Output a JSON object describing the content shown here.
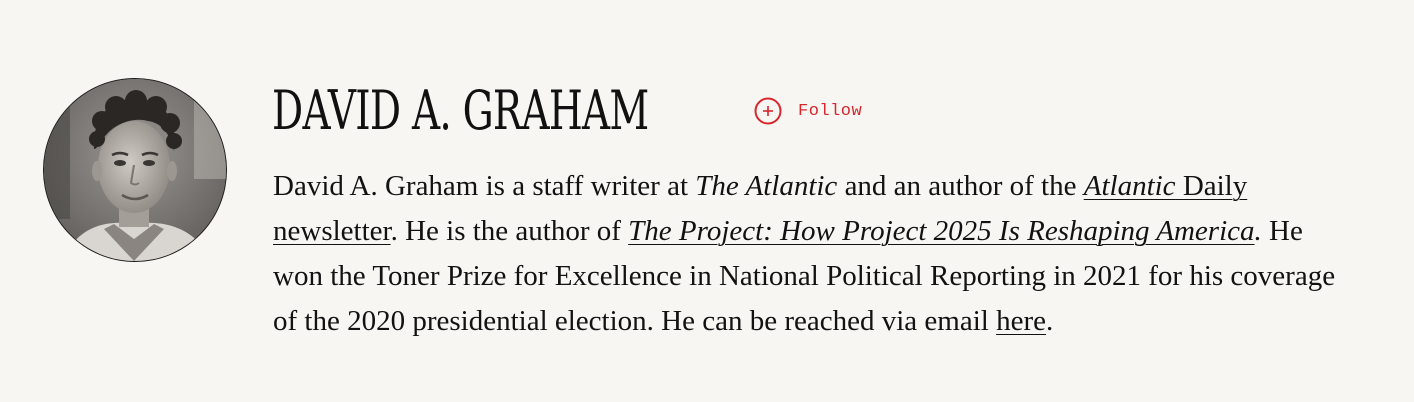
{
  "author": {
    "name": "DAVID A. GRAHAM",
    "avatar_alt": "David A. Graham",
    "follow_label": "Follow"
  },
  "bio": {
    "t1": "David A. Graham is a staff writer at ",
    "publication": "The Atlantic",
    "t2": " and an author of the ",
    "newsletter_italic": "Atlantic",
    "newsletter_rest": " Daily newsletter",
    "t3": ". He is the author of ",
    "book_title": "The Project: How Project 2025 Is Reshaping America",
    "book_period": ".",
    "t4": " He won the Toner Prize for Excellence in National Political Reporting in 2021 for his coverage of the 2020 presidential election. He can be reached via email ",
    "email_link": "here",
    "t5": "."
  },
  "colors": {
    "background": "#f7f6f3",
    "text": "#121212",
    "accent": "#d7262e"
  },
  "icons": {
    "follow": "plus-circle-icon"
  }
}
